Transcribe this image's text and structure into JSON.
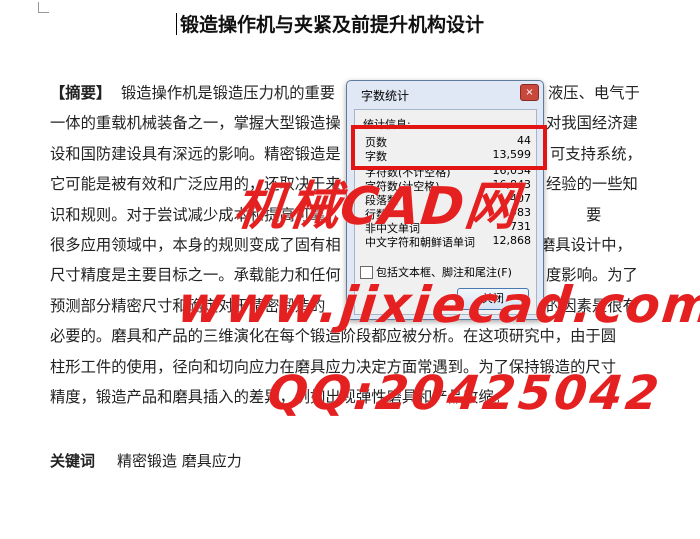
{
  "document": {
    "title": "锻造操作机与夹紧及前提升机构设计",
    "abstract_label": "【摘要】",
    "abstract_lines": [
      "锻造操作机是锻造压力机的重要",
      "一体的重载机械装备之一，掌握大型锻造操",
      "设和国防建设具有深远的影响。精密锻造是",
      "它可能是被有效和广泛应用的，还取决于来",
      "识和规则。对于尝试减少成本和提高可靠",
      "很多应用领域中，本身的规则变成了固有相",
      "尺寸精度是主要目标之一。承载能力和任何",
      "预测部分精密尺寸和确定对于精密锻造的",
      "必要的。磨具和产品的三维演化在每个锻造阶段都应被分析。在这项研究中，由于圆",
      "柱形工件的使用，径向和切向应力在磨具应力决定方面常遇到。为了保持锻造的尺寸",
      "精度，锻造产品和磨具插入的差异，例如出现弹性磨具和产品收缩。"
    ],
    "abstract_line_tails": [
      "液压、电气于",
      "对我国经济建",
      "可支持系统，",
      "经验的一些知",
      "要",
      "磨具设计中，",
      "度影响。为了",
      "的因素是很有",
      "",
      "",
      ""
    ],
    "keywords_label": "关键词",
    "keywords": "精密锻造 磨具应力"
  },
  "dialog": {
    "title": "字数统计",
    "close_icon": "×",
    "section_label": "统计信息:",
    "stats": [
      {
        "label": "页数",
        "value": "44"
      },
      {
        "label": "字数",
        "value": "13,599"
      },
      {
        "label": "字符数(不计空格)",
        "value": "16,034"
      },
      {
        "label": "字符数(计空格)",
        "value": "16,843"
      },
      {
        "label": "段落数",
        "value": "407"
      },
      {
        "label": "行数",
        "value": "983"
      },
      {
        "label": "非中文单词",
        "value": "731"
      },
      {
        "label": "中文字符和朝鲜语单词",
        "value": "12,868"
      }
    ],
    "checkbox_label": "包括文本框、脚注和尾注(F)",
    "close_button": "关闭"
  },
  "watermark": {
    "line1": "机械CAD网",
    "line2": "www.jixiecad.com",
    "line3": "QQ:20425042"
  },
  "colors": {
    "highlight": "#e21414",
    "watermark": "#e52020",
    "dialog_bg": "#dfe8f4"
  }
}
